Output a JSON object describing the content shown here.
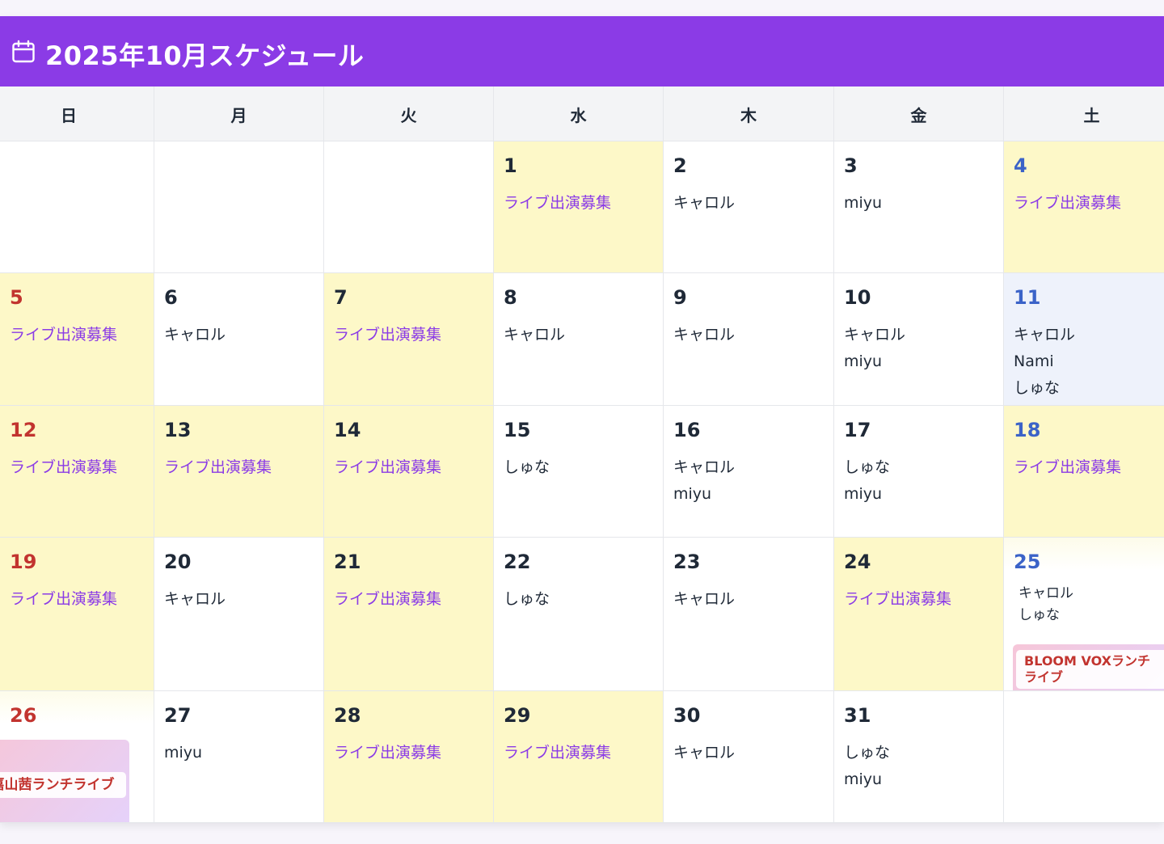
{
  "header": {
    "title": "2025年10月スケジュール",
    "icon": "calendar-icon"
  },
  "weekdays": [
    "日",
    "月",
    "火",
    "水",
    "木",
    "金",
    "土"
  ],
  "colors": {
    "accent": "#8b3be6",
    "saturday": "#3b63c8",
    "sunday": "#c2342f",
    "recruit_bg": "#fdf8c8"
  },
  "cells": [
    {
      "col": 0,
      "row": 0,
      "day": "",
      "bg": "white",
      "events": []
    },
    {
      "col": 1,
      "row": 0,
      "day": "",
      "bg": "white",
      "events": []
    },
    {
      "col": 2,
      "row": 0,
      "day": "",
      "bg": "white",
      "events": []
    },
    {
      "col": 3,
      "row": 0,
      "day": "1",
      "bg": "yellow",
      "events": [
        {
          "text": "ライブ出演募集",
          "style": "purple"
        }
      ]
    },
    {
      "col": 4,
      "row": 0,
      "day": "2",
      "bg": "white",
      "events": [
        {
          "text": "キャロル"
        }
      ]
    },
    {
      "col": 5,
      "row": 0,
      "day": "3",
      "bg": "white",
      "events": [
        {
          "text": "miyu"
        }
      ]
    },
    {
      "col": 6,
      "row": 0,
      "day": "4",
      "bg": "yellow",
      "events": [
        {
          "text": "ライブ出演募集",
          "style": "purple"
        }
      ]
    },
    {
      "col": 0,
      "row": 1,
      "day": "5",
      "bg": "yellow",
      "events": [
        {
          "text": "ライブ出演募集",
          "style": "purple"
        }
      ]
    },
    {
      "col": 1,
      "row": 1,
      "day": "6",
      "bg": "white",
      "events": [
        {
          "text": "キャロル"
        }
      ]
    },
    {
      "col": 2,
      "row": 1,
      "day": "7",
      "bg": "yellow",
      "events": [
        {
          "text": "ライブ出演募集",
          "style": "purple"
        }
      ]
    },
    {
      "col": 3,
      "row": 1,
      "day": "8",
      "bg": "white",
      "events": [
        {
          "text": "キャロル"
        }
      ]
    },
    {
      "col": 4,
      "row": 1,
      "day": "9",
      "bg": "white",
      "events": [
        {
          "text": "キャロル"
        }
      ]
    },
    {
      "col": 5,
      "row": 1,
      "day": "10",
      "bg": "white",
      "events": [
        {
          "text": "キャロル"
        },
        {
          "text": "miyu"
        }
      ]
    },
    {
      "col": 6,
      "row": 1,
      "day": "11",
      "bg": "blue",
      "events": [
        {
          "text": "キャロル"
        },
        {
          "text": "Nami"
        },
        {
          "text": "しゅな"
        }
      ]
    },
    {
      "col": 0,
      "row": 2,
      "day": "12",
      "bg": "yellow",
      "events": [
        {
          "text": "ライブ出演募集",
          "style": "purple"
        }
      ]
    },
    {
      "col": 1,
      "row": 2,
      "day": "13",
      "bg": "yellow",
      "events": [
        {
          "text": "ライブ出演募集",
          "style": "purple"
        }
      ]
    },
    {
      "col": 2,
      "row": 2,
      "day": "14",
      "bg": "yellow",
      "events": [
        {
          "text": "ライブ出演募集",
          "style": "purple"
        }
      ]
    },
    {
      "col": 3,
      "row": 2,
      "day": "15",
      "bg": "white",
      "events": [
        {
          "text": "しゅな"
        }
      ]
    },
    {
      "col": 4,
      "row": 2,
      "day": "16",
      "bg": "white",
      "events": [
        {
          "text": "キャロル"
        },
        {
          "text": "miyu"
        }
      ]
    },
    {
      "col": 5,
      "row": 2,
      "day": "17",
      "bg": "white",
      "events": [
        {
          "text": "しゅな"
        },
        {
          "text": "miyu"
        }
      ]
    },
    {
      "col": 6,
      "row": 2,
      "day": "18",
      "bg": "yellow",
      "events": [
        {
          "text": "ライブ出演募集",
          "style": "purple"
        }
      ]
    },
    {
      "col": 0,
      "row": 3,
      "day": "19",
      "bg": "yellow",
      "events": [
        {
          "text": "ライブ出演募集",
          "style": "purple"
        }
      ]
    },
    {
      "col": 1,
      "row": 3,
      "day": "20",
      "bg": "white",
      "events": [
        {
          "text": "キャロル"
        }
      ]
    },
    {
      "col": 2,
      "row": 3,
      "day": "21",
      "bg": "yellow",
      "events": [
        {
          "text": "ライブ出演募集",
          "style": "purple"
        }
      ]
    },
    {
      "col": 3,
      "row": 3,
      "day": "22",
      "bg": "white",
      "events": [
        {
          "text": "しゅな"
        }
      ]
    },
    {
      "col": 4,
      "row": 3,
      "day": "23",
      "bg": "white",
      "events": [
        {
          "text": "キャロル"
        }
      ]
    },
    {
      "col": 5,
      "row": 3,
      "day": "24",
      "bg": "yellow",
      "events": [
        {
          "text": "ライブ出演募集",
          "style": "purple"
        }
      ]
    },
    {
      "col": 6,
      "row": 3,
      "day": "25",
      "bg": "fade",
      "mini": [
        "キャロル",
        "しゅな"
      ],
      "live": "BLOOM VOXランチライブ",
      "events": []
    },
    {
      "col": 0,
      "row": 4,
      "day": "26",
      "bg": "fade",
      "live": "嘉山茜ランチライブ",
      "events": []
    },
    {
      "col": 1,
      "row": 4,
      "day": "27",
      "bg": "white",
      "events": [
        {
          "text": "miyu"
        }
      ]
    },
    {
      "col": 2,
      "row": 4,
      "day": "28",
      "bg": "yellow",
      "events": [
        {
          "text": "ライブ出演募集",
          "style": "purple"
        }
      ]
    },
    {
      "col": 3,
      "row": 4,
      "day": "29",
      "bg": "yellow",
      "events": [
        {
          "text": "ライブ出演募集",
          "style": "purple"
        }
      ]
    },
    {
      "col": 4,
      "row": 4,
      "day": "30",
      "bg": "white",
      "events": [
        {
          "text": "キャロル"
        }
      ]
    },
    {
      "col": 5,
      "row": 4,
      "day": "31",
      "bg": "white",
      "events": [
        {
          "text": "しゅな"
        },
        {
          "text": "miyu"
        }
      ]
    },
    {
      "col": 6,
      "row": 4,
      "day": "",
      "bg": "white",
      "events": []
    }
  ]
}
